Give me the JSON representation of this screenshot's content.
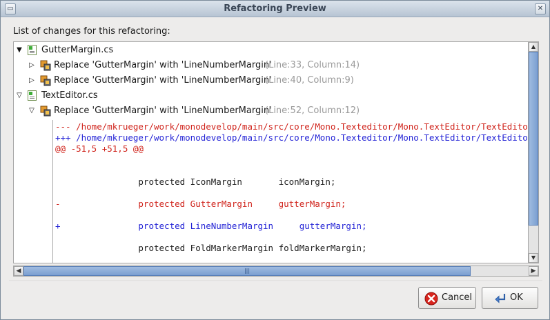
{
  "window": {
    "title": "Refactoring Preview"
  },
  "list_label": "List of changes for this refactoring:",
  "tree": {
    "files": [
      {
        "name": "GutterMargin.cs",
        "changes": [
          {
            "text": "Replace 'GutterMargin' with 'LineNumberMargin'",
            "location": "(Line:33, Column:14)"
          },
          {
            "text": "Replace 'GutterMargin' with 'LineNumberMargin'",
            "location": "(Line:40, Column:9)"
          }
        ]
      },
      {
        "name": "TextEditor.cs",
        "changes": [
          {
            "text": "Replace 'GutterMargin' with 'LineNumberMargin'",
            "location": "(Line:52, Column:12)"
          }
        ]
      }
    ]
  },
  "diff": {
    "lines": [
      "--- /home/mkrueger/work/monodevelop/main/src/core/Mono.Texteditor/Mono.TextEditor/TextEditor.cs",
      "+++ /home/mkrueger/work/monodevelop/main/src/core/Mono.Texteditor/Mono.TextEditor/TextEditor.cs",
      "@@ -51,5 +51,5 @@",
      "                protected IconMargin       iconMargin;",
      "-               protected GutterMargin     gutterMargin;",
      "+               protected LineNumberMargin     gutterMargin;",
      "                protected FoldMarkerMargin foldMarkerMargin;"
    ]
  },
  "buttons": {
    "cancel": "Cancel",
    "ok": "OK"
  },
  "colors": {
    "removed": "#d0241c",
    "added": "#2424d6",
    "scroll_thumb": "#7b9fd1"
  }
}
